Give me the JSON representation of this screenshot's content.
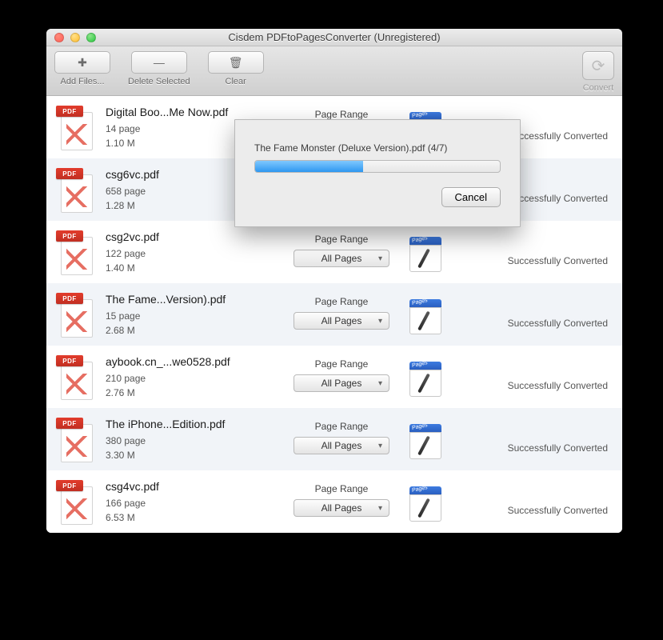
{
  "window": {
    "title": "Cisdem PDFtoPagesConverter (Unregistered)"
  },
  "toolbar": {
    "add": {
      "glyph": "✚",
      "label": "Add Files..."
    },
    "delete": {
      "glyph": "—",
      "label": "Delete Selected"
    },
    "clear": {
      "glyph": "🗑",
      "label": "Clear"
    },
    "convert": {
      "glyph": "⟳",
      "label": "Convert"
    }
  },
  "dialog": {
    "text": "The Fame Monster (Deluxe Version).pdf (4/7)",
    "cancel": "Cancel",
    "progress_percent": 44
  },
  "labels": {
    "page_range": "Page Range",
    "all_pages": "All Pages",
    "status_success": "Successfully Converted"
  },
  "files": [
    {
      "name": "Digital Boo...Me Now.pdf",
      "pages": "14 page",
      "size": "1.10 M"
    },
    {
      "name": "csg6vc.pdf",
      "pages": "658 page",
      "size": "1.28 M"
    },
    {
      "name": "csg2vc.pdf",
      "pages": "122 page",
      "size": "1.40 M"
    },
    {
      "name": "The Fame...Version).pdf",
      "pages": "15 page",
      "size": "2.68 M"
    },
    {
      "name": "aybook.cn_...we0528.pdf",
      "pages": "210 page",
      "size": "2.76 M"
    },
    {
      "name": "The iPhone...Edition.pdf",
      "pages": "380 page",
      "size": "3.30 M"
    },
    {
      "name": "csg4vc.pdf",
      "pages": "166 page",
      "size": "6.53 M"
    }
  ]
}
